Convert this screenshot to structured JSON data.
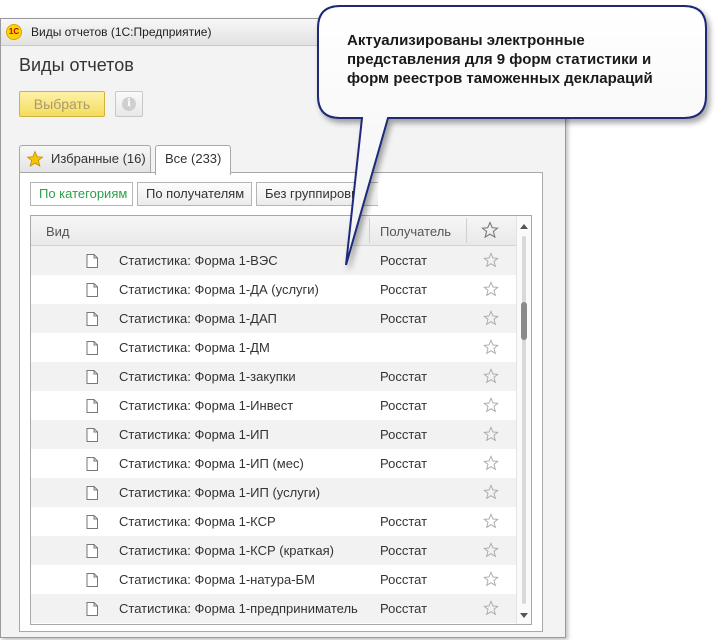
{
  "window": {
    "title": "Виды отчетов  (1С:Предприятие)",
    "logo_text": "1С"
  },
  "form": {
    "title": "Виды отчетов"
  },
  "toolbar": {
    "select_label": "Выбрать",
    "info_label": "i"
  },
  "tabs": [
    {
      "label": "Избранные (16)",
      "active": false
    },
    {
      "label": "Все (233)",
      "active": true
    }
  ],
  "grouping": [
    {
      "label": "По категориям",
      "active": true
    },
    {
      "label": "По получателям",
      "active": false
    },
    {
      "label": "Без группировки",
      "active": false
    }
  ],
  "grid": {
    "columns": {
      "name": "Вид",
      "recipient": "Получатель"
    },
    "rows": [
      {
        "name": "Статистика: Форма 1-ВЭС",
        "recipient": "Росстат"
      },
      {
        "name": "Статистика: Форма 1-ДА (услуги)",
        "recipient": "Росстат"
      },
      {
        "name": "Статистика: Форма 1-ДАП",
        "recipient": "Росстат"
      },
      {
        "name": "Статистика: Форма 1-ДМ",
        "recipient": ""
      },
      {
        "name": "Статистика: Форма 1-закупки",
        "recipient": "Росстат"
      },
      {
        "name": "Статистика: Форма 1-Инвест",
        "recipient": "Росстат"
      },
      {
        "name": "Статистика: Форма 1-ИП",
        "recipient": "Росстат"
      },
      {
        "name": "Статистика: Форма 1-ИП (мес)",
        "recipient": "Росстат"
      },
      {
        "name": "Статистика: Форма 1-ИП (услуги)",
        "recipient": ""
      },
      {
        "name": "Статистика: Форма 1-КСР",
        "recipient": "Росстат"
      },
      {
        "name": "Статистика: Форма 1-КСР (краткая)",
        "recipient": "Росстат"
      },
      {
        "name": "Статистика: Форма 1-натура-БМ",
        "recipient": "Росстат"
      },
      {
        "name": "Статистика: Форма 1-предприниматель",
        "recipient": "Росстат"
      }
    ]
  },
  "callout": {
    "lines": [
      "Актуализированы электронные",
      "представления для 9 форм статистики и",
      "форм реестров таможенных деклараций"
    ]
  },
  "colors": {
    "accent_green": "#2e9e4a",
    "select_button": "#f5dc5e",
    "callout_border": "#1f2a78",
    "star_yellow": "#f6c400"
  }
}
